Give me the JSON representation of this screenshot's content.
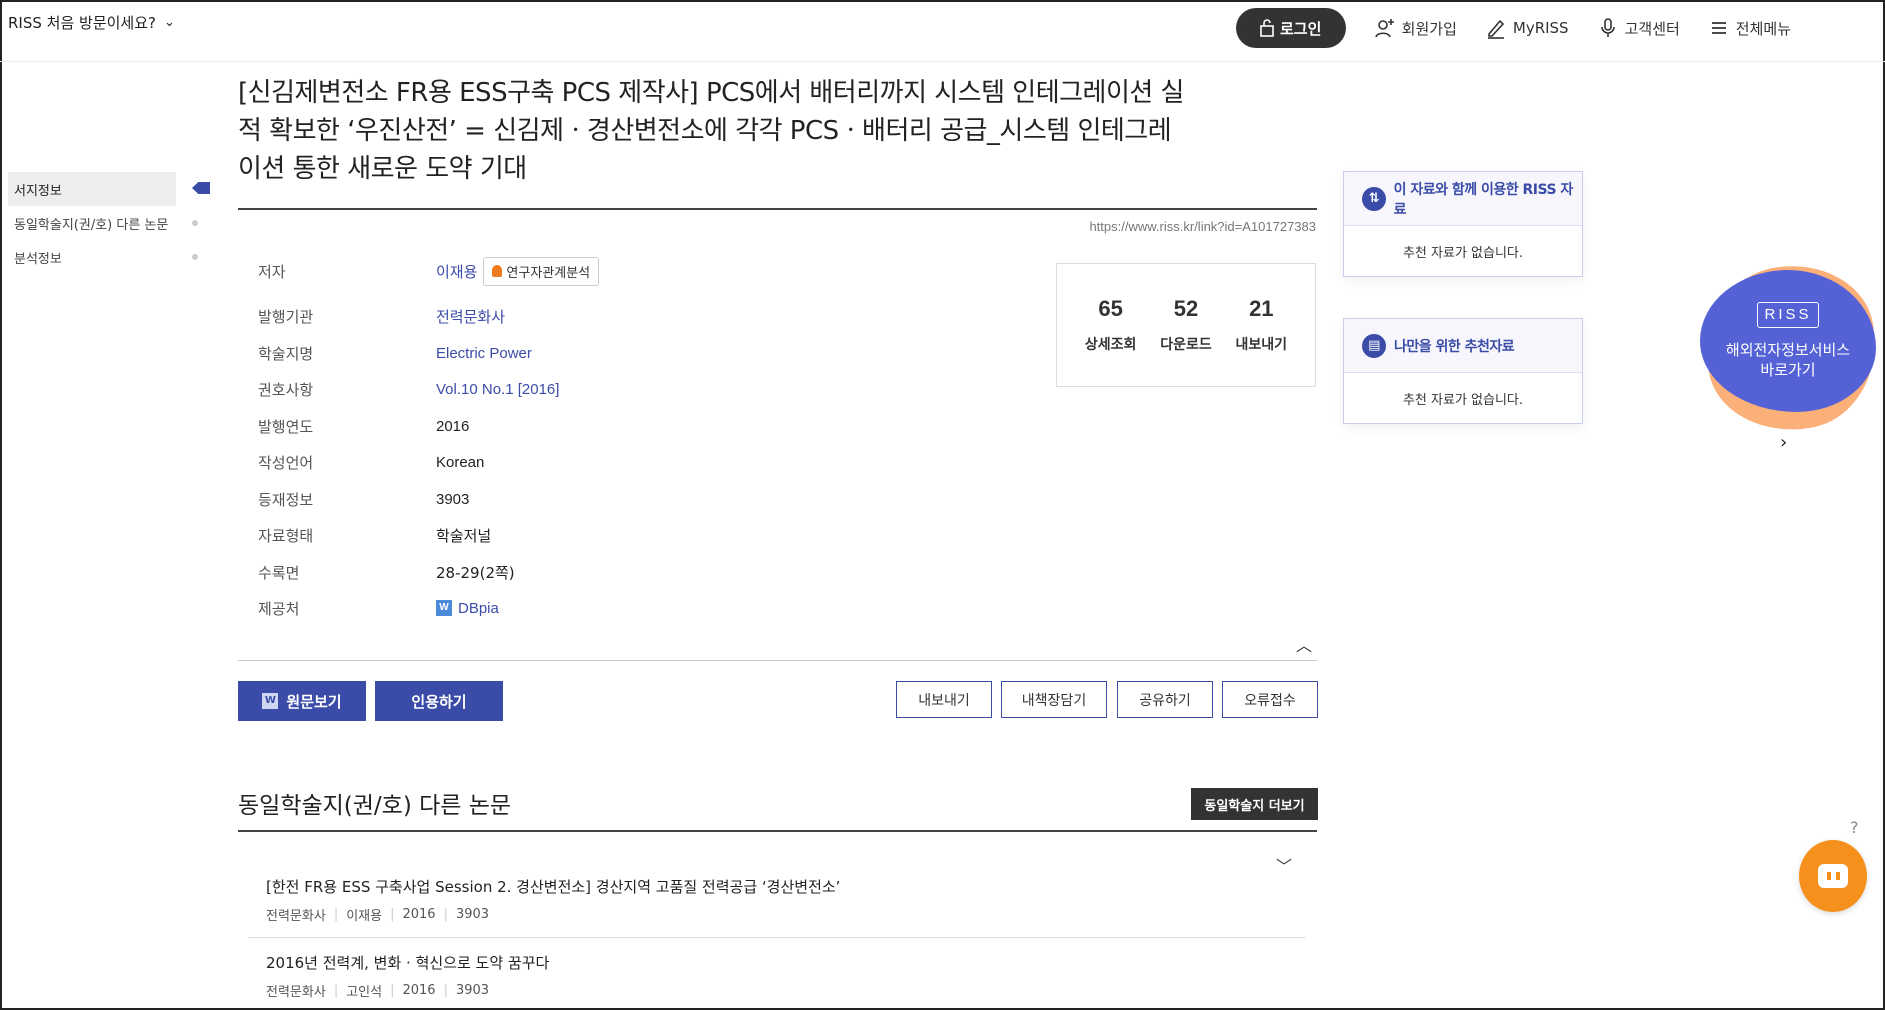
{
  "header": {
    "first_visit": "RISS 처음 방문이세요?",
    "login": "로그인",
    "join": "회원가입",
    "myriss": "MyRISS",
    "support": "고객센터",
    "all_menu": "전체메뉴"
  },
  "lnb": {
    "items": [
      {
        "label": "서지정보"
      },
      {
        "label": "동일학술지(권/호) 다른 논문"
      },
      {
        "label": "분석정보"
      }
    ]
  },
  "article": {
    "title": "[신김제변전소 FR용 ESS구축 PCS 제작사] PCS에서 배터리까지 시스템 인테그레이션 실적 확보한 ‘우진산전’ = 신김제ㆍ경산변전소에 각각 PCSㆍ배터리 공급_시스템 인테그레이션 통한 새로운 도약 기대",
    "url": "https://www.riss.kr/link?id=A101727383"
  },
  "info": {
    "rows": [
      {
        "label": "저자",
        "value": "이재용",
        "chip": "연구자관계분석"
      },
      {
        "label": "발행기관",
        "value": "전력문화사"
      },
      {
        "label": "학술지명",
        "value": "Electric Power"
      },
      {
        "label": "권호사항",
        "value": "Vol.10 No.1 [2016]"
      },
      {
        "label": "발행연도",
        "value": "2016"
      },
      {
        "label": "작성언어",
        "value": "Korean"
      },
      {
        "label": "등재정보",
        "value": "3903"
      },
      {
        "label": "자료형태",
        "value": "학술저널"
      },
      {
        "label": "수록면",
        "value": "28-29(2쪽)"
      },
      {
        "label": "제공처",
        "value": "DBpia",
        "badge": "W"
      }
    ]
  },
  "stats": [
    {
      "num": "65",
      "label": "상세조회"
    },
    {
      "num": "52",
      "label": "다운로드"
    },
    {
      "num": "21",
      "label": "내보내기"
    }
  ],
  "actions": {
    "view_original": "원문보기",
    "view_badge": "W",
    "cite": "인용하기",
    "export": "내보내기",
    "bookshelf": "내책장담기",
    "share": "공유하기",
    "report": "오류접수"
  },
  "same_journal": {
    "title": "동일학술지(권/호) 다른 논문",
    "more": "동일학술지 더보기",
    "papers": [
      {
        "title": "[한전 FR용 ESS 구축사업 Session 2. 경산변전소] 경산지역 고품질 전력공급 ‘경산변전소’",
        "publisher": "전력문화사",
        "author": "이재용",
        "year": "2016",
        "kci": "3903"
      },
      {
        "title": "2016년 전력계, 변화 · 혁신으로 도약 꿈꾸다",
        "publisher": "전력문화사",
        "author": "고인석",
        "year": "2016",
        "kci": "3903"
      }
    ]
  },
  "side": {
    "box1": {
      "title": "이 자료와 함께 이용한 RISS 자료",
      "empty": "추천 자료가 없습니다."
    },
    "box2": {
      "title": "나만을 위한 추천자료",
      "empty": "추천 자료가 없습니다."
    }
  },
  "banner": {
    "logo": "RISS",
    "line1": "해외전자정보서비스",
    "line2": "바로가기"
  },
  "help": "?"
}
